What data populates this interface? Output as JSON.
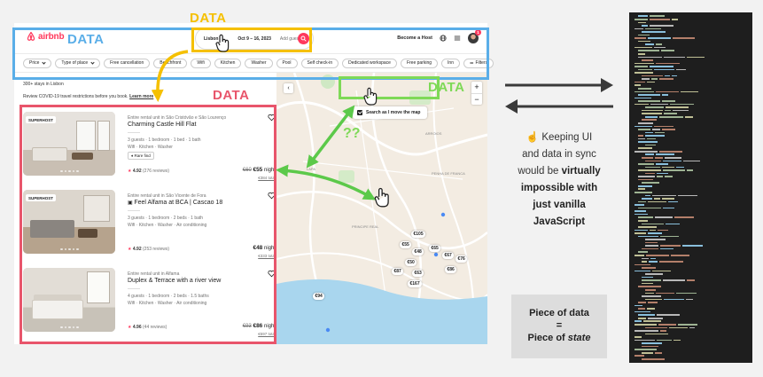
{
  "annotations": {
    "label_yellow": "DATA",
    "label_blue": "DATA",
    "label_red": "DATA",
    "label_green": "DATA",
    "question": "??",
    "sync_line1": "Keeping UI",
    "sync_line2": "and data in sync",
    "sync_line3a": "would be ",
    "sync_line3b": "virtually",
    "sync_line4": "impossible with",
    "sync_line5": "just vanilla",
    "sync_line6": "JavaScript",
    "sync_emoji": "☝️",
    "piece_line1": "Piece of data",
    "piece_line2": "=",
    "piece_line3a": "Piece of ",
    "piece_line3b": "state",
    "colors": {
      "yellow": "#f5c000",
      "blue": "#5aaee8",
      "red": "#e8556b",
      "green": "#7ed957"
    }
  },
  "header": {
    "logo": "airbnb",
    "search": {
      "location": "Lisbon",
      "dates": "Oct 9 – 16, 2023",
      "guests": "Add guests"
    },
    "become_host": "Become a Host",
    "notifications": "1"
  },
  "filters": [
    {
      "label": "Price",
      "dropdown": true
    },
    {
      "label": "Type of place",
      "dropdown": true
    },
    {
      "label": "Free cancellation",
      "dropdown": false
    },
    {
      "label": "Beachfront",
      "dropdown": false
    },
    {
      "label": "Wifi",
      "dropdown": false
    },
    {
      "label": "Kitchen",
      "dropdown": false
    },
    {
      "label": "Washer",
      "dropdown": false
    },
    {
      "label": "Pool",
      "dropdown": false
    },
    {
      "label": "Self check-in",
      "dropdown": false
    },
    {
      "label": "Dedicated workspace",
      "dropdown": false
    },
    {
      "label": "Free parking",
      "dropdown": false
    },
    {
      "label": "Inn",
      "dropdown": false
    },
    {
      "label": "Filters",
      "dropdown": false
    }
  ],
  "listing": {
    "count_text": "300+ stays in Lisbon",
    "covid_text": "Review COVID-19 travel restrictions before you book.",
    "covid_link": "Learn more",
    "cards": [
      {
        "badge": "SUPERHOST",
        "subtitle": "Entire rental unit in São Cristóvão e São Lourenço",
        "title": "Charming Castle Hill Flat",
        "info1": "3 guests · 1 bedroom · 1 bed · 1 bath",
        "info2": "Wifi · Kitchen · Washer",
        "tag": "Rare find",
        "rating": "4.92",
        "reviews": "(276 reviews)",
        "old_price": "€60",
        "price": "€55",
        "per": "night",
        "total": "€384 total"
      },
      {
        "badge": "SUPERHOST",
        "subtitle": "Entire rental unit in São Vicente de Fora",
        "title": "Feel Alfama at BCA | Cascao 18",
        "info1": "3 guests · 1 bedroom · 2 beds · 1 bath",
        "info2": "Wifi · Kitchen · Washer · Air conditioning",
        "tag": "",
        "rating": "4.92",
        "reviews": "(253 reviews)",
        "old_price": "",
        "price": "€48",
        "per": "night",
        "total": "€333 total"
      },
      {
        "badge": "",
        "subtitle": "Entire rental unit in Alfama",
        "title": "Duplex & Terrace with a river view",
        "info1": "4 guests · 1 bedroom · 2 beds · 1.5 baths",
        "info2": "Wifi · Kitchen · Washer · Air conditioning",
        "tag": "",
        "rating": "4.96",
        "reviews": "(44 reviews)",
        "old_price": "€93",
        "price": "€86",
        "per": "night",
        "total": "€597 total"
      }
    ]
  },
  "map": {
    "checkbox_label": "Search as I move the map",
    "zoom_in": "+",
    "zoom_out": "−",
    "back": "‹",
    "labels": [
      "LAPA",
      "PRINCIPE REAL",
      "PENHA DE FRANCA",
      "ARROIOS"
    ],
    "pins": [
      "€105",
      "€55",
      "€48",
      "€65",
      "€67",
      "€76",
      "€50",
      "€87",
      "€86",
      "€63",
      "€167",
      "€94"
    ]
  }
}
